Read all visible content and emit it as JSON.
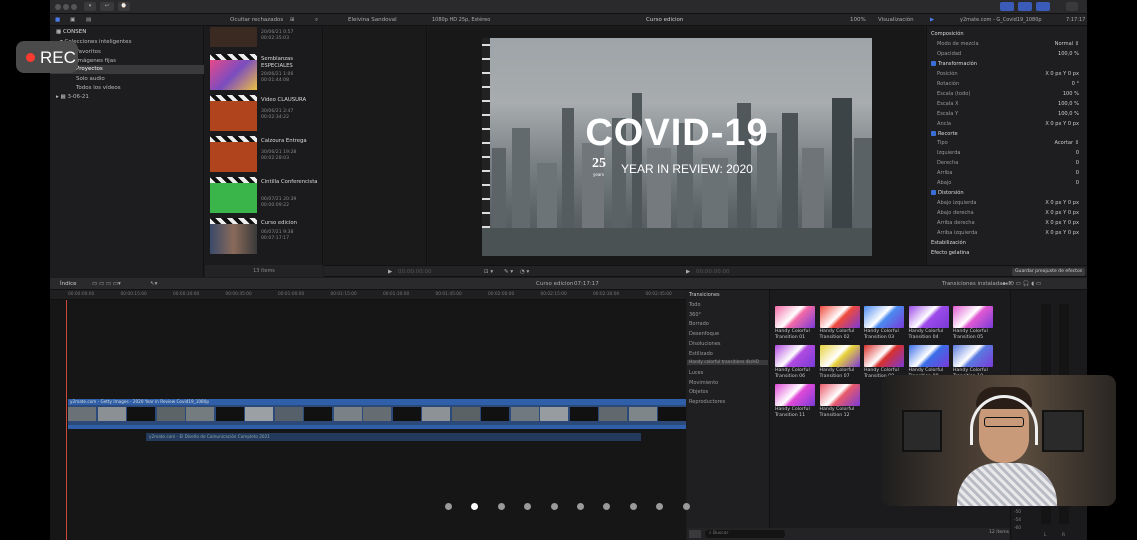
{
  "recording": {
    "label": "REC"
  },
  "toolbar": {
    "labels": [
      "▾",
      "↩",
      "⌚"
    ]
  },
  "library": {
    "name": "CONSEN",
    "items": [
      "Colecciones inteligentes",
      "Favoritos",
      "Imágenes fijas",
      "Proyectos",
      "Solo audio",
      "Todos los vídeos"
    ],
    "event": "3-06-21"
  },
  "browser": {
    "filter": "Ocultar rechazados",
    "count": "13 ítems",
    "clips": [
      {
        "name": "",
        "date": "20/06/21 0:57",
        "dur": "00:02:35:03",
        "color": "#3b2a22"
      },
      {
        "name": "Semblanzas ESPECIALES",
        "date": "20/06/21 1:06",
        "dur": "00:01:44:08",
        "color": "#7a4cc0"
      },
      {
        "name": "Video CLAUSURA",
        "date": "30/06/21 2:47",
        "dur": "00:02:34:22",
        "color": "#b0451d"
      },
      {
        "name": "Calzoura Entrega",
        "date": "30/06/21 19:28",
        "dur": "00:02:28:03",
        "color": "#b0451d"
      },
      {
        "name": "Cintilla Conferencista",
        "date": "06/07/21 20:39",
        "dur": "00:00:09:22",
        "color": "#3ab54a"
      },
      {
        "name": "Curso edicion",
        "date": "06/07/21 9:38",
        "dur": "00:07:17:17",
        "color": "#6a5a50"
      }
    ]
  },
  "viewer_bar": {
    "user": "Eleivina Sandoval",
    "format": "1080p HD 25p, Estéreo",
    "project": "Curso edicion",
    "zoom": "100%",
    "view": "Visualización"
  },
  "video": {
    "title": "COVID-19",
    "logo": "25",
    "logo_sub": "years",
    "subtitle": "YEAR IN REVIEW: 2020"
  },
  "inspector": {
    "file": "y2mate.com - G_Covid19_1080p",
    "duration": "7:17:17",
    "rows": [
      {
        "label": "Composición",
        "value": "",
        "head": true,
        "cb": false
      },
      {
        "label": "Modo de mezcla",
        "value": "Normal ⇕",
        "head": false,
        "cb": false
      },
      {
        "label": "Opacidad",
        "value": "100,0 %",
        "head": false,
        "cb": false
      },
      {
        "label": "Transformación",
        "value": "",
        "head": true,
        "cb": true
      },
      {
        "label": "Posición",
        "value": "X  0 px   Y  0 px",
        "head": false,
        "cb": false
      },
      {
        "label": "Rotación",
        "value": "0 °",
        "head": false,
        "cb": false
      },
      {
        "label": "Escala (todo)",
        "value": "100 %",
        "head": false,
        "cb": false
      },
      {
        "label": "Escala X",
        "value": "100,0 %",
        "head": false,
        "cb": false
      },
      {
        "label": "Escala Y",
        "value": "100,0 %",
        "head": false,
        "cb": false
      },
      {
        "label": "Ancla",
        "value": "X  0 px   Y  0 px",
        "head": false,
        "cb": false
      },
      {
        "label": "Recorte",
        "value": "",
        "head": true,
        "cb": true
      },
      {
        "label": "Tipo",
        "value": "Acortar ⇕",
        "head": false,
        "cb": false
      },
      {
        "label": "Izquierda",
        "value": "0",
        "head": false,
        "cb": false
      },
      {
        "label": "Derecha",
        "value": "0",
        "head": false,
        "cb": false
      },
      {
        "label": "Arriba",
        "value": "0",
        "head": false,
        "cb": false
      },
      {
        "label": "Abajo",
        "value": "0",
        "head": false,
        "cb": false
      },
      {
        "label": "Distorsión",
        "value": "",
        "head": true,
        "cb": true
      },
      {
        "label": "Abajo izquierda",
        "value": "X  0 px   Y  0 px",
        "head": false,
        "cb": false
      },
      {
        "label": "Abajo derecha",
        "value": "X  0 px   Y  0 px",
        "head": false,
        "cb": false
      },
      {
        "label": "Arriba derecha",
        "value": "X  0 px   Y  0 px",
        "head": false,
        "cb": false
      },
      {
        "label": "Arriba izquierda",
        "value": "X  0 px   Y  0 px",
        "head": false,
        "cb": false
      },
      {
        "label": "Estabilización",
        "value": "",
        "head": true,
        "cb": false
      },
      {
        "label": "Efecto gelatina",
        "value": "",
        "head": true,
        "cb": false
      }
    ],
    "save_button": "Guardar preajuste de efectos"
  },
  "timeline": {
    "index": "Índice",
    "project": "Curso edicion",
    "time": "07:17:17",
    "ticks": [
      "00:00:00:00",
      "00:00:15:00",
      "00:00:30:00",
      "00:00:45:00",
      "00:01:00:00",
      "00:01:15:00",
      "00:01:30:00",
      "00:01:45:00",
      "00:02:00:00",
      "00:02:15:00",
      "00:02:30:00",
      "00:02:45:00"
    ],
    "clip_label": "y2mate.com - Getty Images - 2020 Year In Review Covid19_1080p",
    "audio_label": "y2mate.com - El Diseño de Comunicación Completo 2021"
  },
  "transitions": {
    "header": "Transiciones",
    "installed": "Transiciones instaladas ⇕",
    "categories": [
      "Todo",
      "360°",
      "Borrado",
      "Desenfoque",
      "Disoluciones",
      "Estilizado",
      "Handy colorful transitions 4k/HD",
      "Luces",
      "Movimiento",
      "Objetos",
      "Reproductores"
    ],
    "tiles": [
      {
        "label": "Handy Colorful Transition 01",
        "color": "#f26aa7"
      },
      {
        "label": "Handy Colorful Transition 02",
        "color": "#ef4a3c"
      },
      {
        "label": "Handy Colorful Transition 03",
        "color": "#4b8bf0"
      },
      {
        "label": "Handy Colorful Transition 04",
        "color": "#9b4ae8"
      },
      {
        "label": "Handy Colorful Transition 05",
        "color": "#e05ad2"
      },
      {
        "label": "Handy Colorful Transition 06",
        "color": "#b04ae0"
      },
      {
        "label": "Handy Colorful Transition 07",
        "color": "#e8d23a"
      },
      {
        "label": "Handy Colorful Transition 08",
        "color": "#d8302c"
      },
      {
        "label": "Handy Colorful Transition 09",
        "color": "#3a6ee8"
      },
      {
        "label": "Handy Colorful Transition 10",
        "color": "#5a7ae0"
      },
      {
        "label": "Handy Colorful Transition 11",
        "color": "#e04ad8"
      },
      {
        "label": "Handy Colorful Transition 12",
        "color": "#e85a6a"
      }
    ],
    "search_placeholder": "Buscar",
    "count": "12 ítems"
  },
  "meters": {
    "labels": [
      "-50",
      "-54",
      "-60",
      "L",
      "R"
    ]
  }
}
